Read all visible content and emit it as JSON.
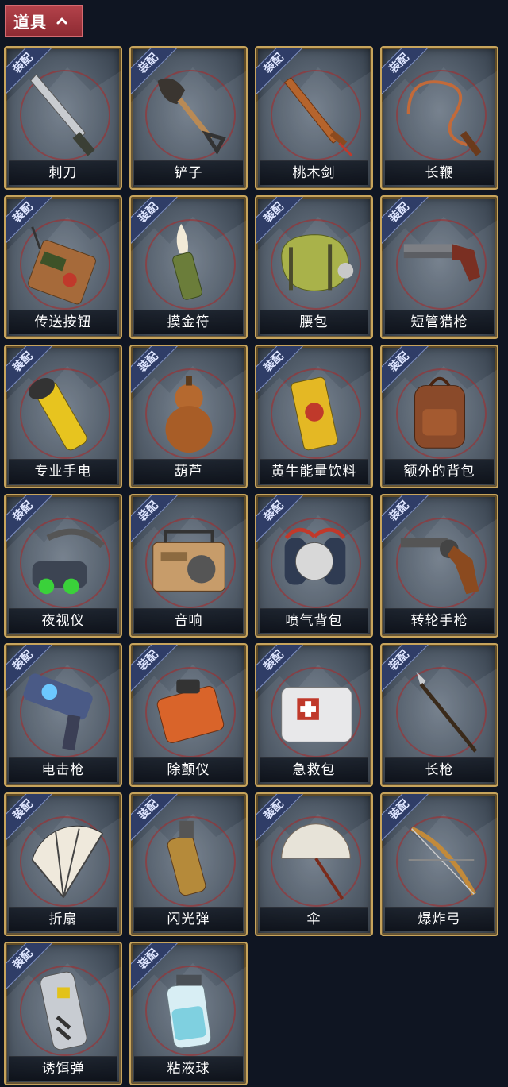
{
  "header": {
    "title": "道具"
  },
  "badge_label": "装配",
  "items": [
    {
      "name": "刺刀",
      "icon": "bayonet-icon"
    },
    {
      "name": "铲子",
      "icon": "shovel-icon"
    },
    {
      "name": "桃木剑",
      "icon": "wooden-sword-icon"
    },
    {
      "name": "长鞭",
      "icon": "whip-icon"
    },
    {
      "name": "传送按钮",
      "icon": "teleport-button-icon"
    },
    {
      "name": "摸金符",
      "icon": "talisman-icon"
    },
    {
      "name": "腰包",
      "icon": "waist-pack-icon"
    },
    {
      "name": "短管猎枪",
      "icon": "sawed-off-shotgun-icon"
    },
    {
      "name": "专业手电",
      "icon": "flashlight-icon"
    },
    {
      "name": "葫芦",
      "icon": "gourd-icon"
    },
    {
      "name": "黄牛能量饮料",
      "icon": "energy-drink-icon"
    },
    {
      "name": "额外的背包",
      "icon": "backpack-icon"
    },
    {
      "name": "夜视仪",
      "icon": "night-vision-icon"
    },
    {
      "name": "音响",
      "icon": "boombox-icon"
    },
    {
      "name": "喷气背包",
      "icon": "jetpack-icon"
    },
    {
      "name": "转轮手枪",
      "icon": "revolver-icon"
    },
    {
      "name": "电击枪",
      "icon": "shock-gun-icon"
    },
    {
      "name": "除颤仪",
      "icon": "defibrillator-icon"
    },
    {
      "name": "急救包",
      "icon": "first-aid-kit-icon"
    },
    {
      "name": "长枪",
      "icon": "spear-icon"
    },
    {
      "name": "折扇",
      "icon": "folding-fan-icon"
    },
    {
      "name": "闪光弹",
      "icon": "flashbang-icon"
    },
    {
      "name": "伞",
      "icon": "umbrella-icon"
    },
    {
      "name": "爆炸弓",
      "icon": "bow-icon"
    },
    {
      "name": "诱饵弹",
      "icon": "decoy-grenade-icon"
    },
    {
      "name": "粘液球",
      "icon": "slime-ball-icon"
    }
  ],
  "colors": {
    "background": "#0f1522",
    "header": "#9b333b",
    "card_border": "#c7a45c",
    "badge": "#2f3d67"
  }
}
